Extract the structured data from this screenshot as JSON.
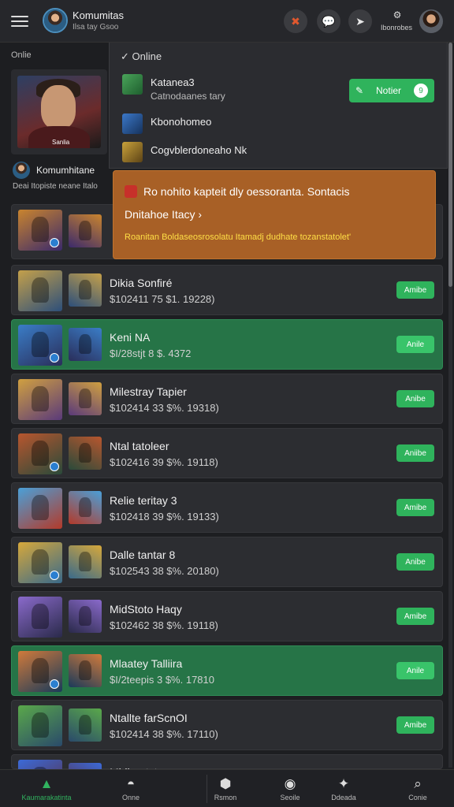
{
  "header": {
    "title": "Komumitas",
    "subtitle": "Ilsa tay Gsoo",
    "small_icon_label": "Ibonrobes"
  },
  "left": {
    "online_label": "Onlie",
    "hero_tag": "Sanlia",
    "community_title": "Komumhitane",
    "community_sub": "Deai Itopiste neane Italo"
  },
  "dropdown": {
    "online_label": "Online",
    "notify_label": "Notier",
    "notify_count": "9",
    "items": [
      {
        "name": "Katanea3",
        "sub": "Catnodaanes tary"
      },
      {
        "name": "Kbonohomeo",
        "sub": ""
      },
      {
        "name": "Cogvblerdoneaho Nk",
        "sub": ""
      }
    ]
  },
  "banner": {
    "line1": "Ro nohito kapteit dly  oessoranta. Sontacis",
    "line2": "Dnitahoe Itacy ›",
    "line3": "Roanitan Boldaseosrosolatu Itamadj dudhate tozanstatolet'"
  },
  "games": [
    {
      "title": "",
      "sub": "",
      "action": ""
    },
    {
      "title": "Dikia Sonfiré",
      "sub": "$102411 75 $1. 19228)",
      "action": "Amibe"
    },
    {
      "title": "Keni NA",
      "sub": "$I/28stjt 8 $. 4372",
      "action": "Anile"
    },
    {
      "title": "Milestray Tapier",
      "sub": "$102414 33 $%. 19318)",
      "action": "Anibe"
    },
    {
      "title": "Ntal tatoleer",
      "sub": "$102416 39 $%. 19118)",
      "action": "Aniibe"
    },
    {
      "title": "Relie teritay 3",
      "sub": "$102418 39 $%. 19133)",
      "action": "Amibe"
    },
    {
      "title": "Dalle tantar 8",
      "sub": "$102543 38 $%. 20180)",
      "action": "Anibe"
    },
    {
      "title": "MidStoto Haqy",
      "sub": "$102462 38 $%. 19118)",
      "action": "Amibe"
    },
    {
      "title": "Mlaatey Talliira",
      "sub": "$I/2teepis 3 $%. 17810",
      "action": "Anile"
    },
    {
      "title": "Ntallte farScnOI",
      "sub": "$102414 38 $%. 17110)",
      "action": "Amibe"
    },
    {
      "title": "Mldhontctar",
      "sub": "",
      "action": ""
    }
  ],
  "nav": [
    {
      "label": "Kaumarakatinta",
      "icon": "home-icon"
    },
    {
      "label": "Onne",
      "icon": "chat-icon"
    },
    {
      "label": "Rsmon",
      "icon": "shield-icon"
    },
    {
      "label": "Seoile",
      "icon": "puzzle-icon"
    },
    {
      "label": "Ddeada",
      "icon": "tree-icon"
    },
    {
      "label": "Conie",
      "icon": "search-icon"
    }
  ]
}
